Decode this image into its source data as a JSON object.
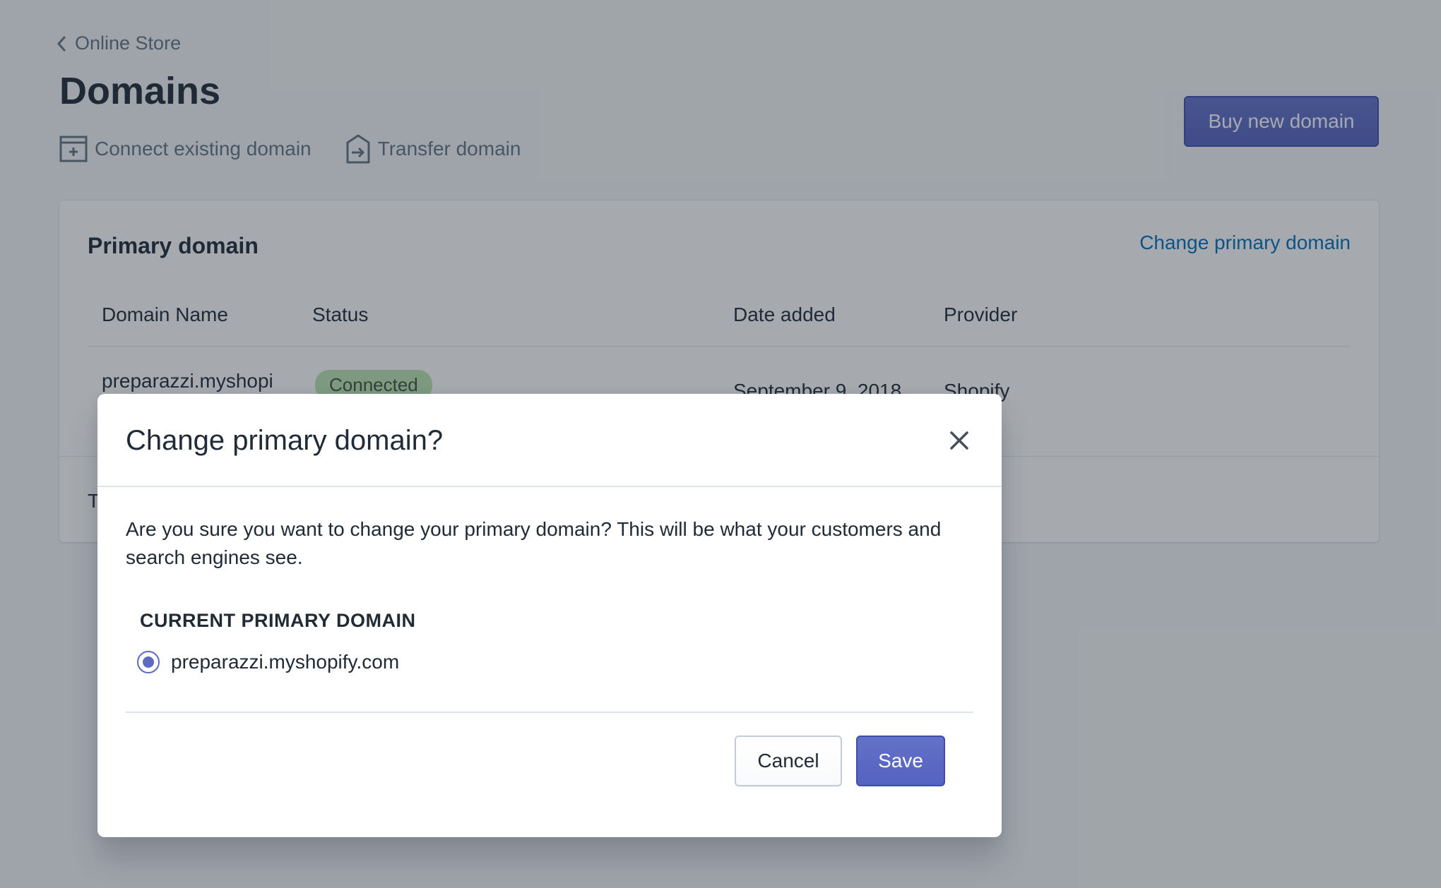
{
  "background": {
    "breadcrumb": {
      "label": "Online Store",
      "icon": "chevron-left-icon"
    },
    "page_title": "Domains",
    "actions": [
      {
        "label": "Connect existing domain",
        "icon": "add-domain-icon"
      },
      {
        "label": "Transfer domain",
        "icon": "transfer-icon"
      }
    ],
    "buy_button_label": "Buy new domain",
    "primary_card": {
      "title": "Primary domain",
      "change_link": "Change primary domain",
      "columns": [
        "Domain Name",
        "Status",
        "Date added",
        "Provider"
      ],
      "row": {
        "domain": "preparazzi.myshopi",
        "status": "Connected",
        "date": "September 9, 2018",
        "provider": "Shopify"
      },
      "footer_text_partial": "T"
    }
  },
  "modal": {
    "title": "Change primary domain?",
    "close_icon": "close-icon",
    "body": "Are you sure you want to change your primary domain? This will be what your customers and search engines see.",
    "section_label": "CURRENT PRIMARY DOMAIN",
    "option": {
      "label": "preparazzi.myshopify.com",
      "selected": true
    },
    "cancel_label": "Cancel",
    "save_label": "Save"
  },
  "colors": {
    "accent": "#5c6ac4",
    "link": "#006fbb",
    "overlay": "rgba(33,43,54,0.4)",
    "badge_success": "#bbe5b3"
  }
}
